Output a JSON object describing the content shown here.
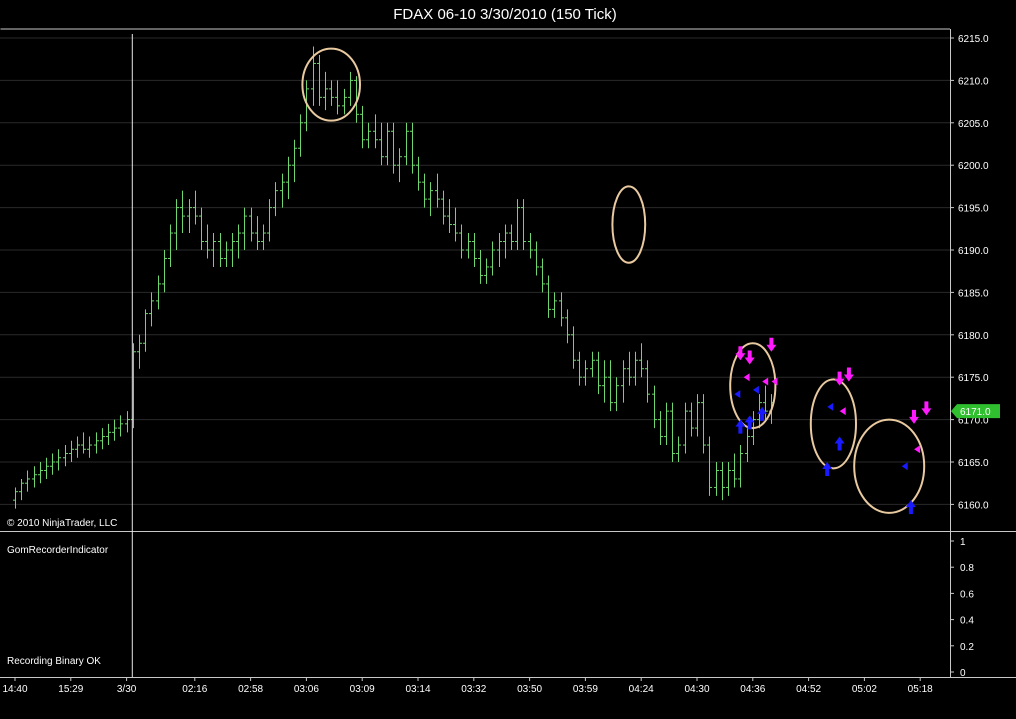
{
  "window": {
    "title": "FDAX 06-10  3/30/2010 (150 Tick)"
  },
  "copyright": "© 2010 NinjaTrader, LLC",
  "indicator_panel": {
    "name": "GomRecorderIndicator",
    "status": "Recording Binary OK",
    "ticks": [
      "1",
      "0.8",
      "0.6",
      "0.4",
      "0.2",
      "0"
    ]
  },
  "colors": {
    "background": "#000000",
    "bar": "#6fd66f",
    "frame": "#c8c8c8",
    "grid": "#2a2a2a",
    "ellipse": "#e8c9a0",
    "sell_marker": "#ff1aff",
    "buy_marker": "#1a1aff",
    "price_tag": "#2fbf2f"
  },
  "chart_data": {
    "type": "ohlc",
    "instrument": "FDAX 06-10",
    "date": "3/30/2010",
    "interval": "150 Tick",
    "y_ticks": [
      "6215.0",
      "6210.0",
      "6205.0",
      "6200.0",
      "6195.0",
      "6190.0",
      "6185.0",
      "6180.0",
      "6175.0",
      "6170.0",
      "6165.0",
      "6160.0"
    ],
    "ylim": [
      6158.5,
      6215.5
    ],
    "x_ticks": [
      {
        "label": "14:40",
        "bar": 0
      },
      {
        "label": "15:29",
        "bar": 9
      },
      {
        "label": "3/30",
        "bar": 18
      },
      {
        "label": "02:16",
        "bar": 29
      },
      {
        "label": "02:58",
        "bar": 38
      },
      {
        "label": "03:06",
        "bar": 47
      },
      {
        "label": "03:09",
        "bar": 56
      },
      {
        "label": "03:14",
        "bar": 65
      },
      {
        "label": "03:32",
        "bar": 74
      },
      {
        "label": "03:50",
        "bar": 83
      },
      {
        "label": "03:59",
        "bar": 92
      },
      {
        "label": "04:24",
        "bar": 101
      },
      {
        "label": "04:30",
        "bar": 110
      },
      {
        "label": "04:36",
        "bar": 119
      },
      {
        "label": "04:52",
        "bar": 128
      },
      {
        "label": "05:02",
        "bar": 137
      },
      {
        "label": "05:18",
        "bar": 146
      }
    ],
    "session_break_bar": 19,
    "last_price": "6171.0",
    "bars": [
      [
        6160.5,
        6162.0,
        6159.5,
        6161.5
      ],
      [
        6161.5,
        6163.0,
        6160.5,
        6162.5
      ],
      [
        6162.5,
        6164.0,
        6161.5,
        6163.0
      ],
      [
        6163.0,
        6164.5,
        6162.0,
        6163.5
      ],
      [
        6163.5,
        6165.0,
        6162.5,
        6164.0
      ],
      [
        6164.0,
        6165.5,
        6163.0,
        6164.5
      ],
      [
        6164.5,
        6166.0,
        6163.5,
        6165.0
      ],
      [
        6165.0,
        6166.5,
        6164.0,
        6165.5
      ],
      [
        6165.5,
        6167.0,
        6164.5,
        6166.0
      ],
      [
        6166.0,
        6167.5,
        6165.0,
        6166.5
      ],
      [
        6166.5,
        6168.0,
        6165.5,
        6167.0
      ],
      [
        6167.0,
        6168.5,
        6166.0,
        6166.5
      ],
      [
        6166.5,
        6168.0,
        6165.5,
        6167.0
      ],
      [
        6167.0,
        6168.5,
        6166.0,
        6167.5
      ],
      [
        6167.5,
        6169.0,
        6166.5,
        6168.0
      ],
      [
        6168.0,
        6169.5,
        6167.0,
        6168.5
      ],
      [
        6168.5,
        6170.0,
        6167.5,
        6169.0
      ],
      [
        6169.0,
        6170.5,
        6168.0,
        6169.5
      ],
      [
        6169.5,
        6171.0,
        6168.5,
        6170.0
      ],
      [
        6170.0,
        6179.0,
        6169.0,
        6178.0
      ],
      [
        6178.0,
        6180.0,
        6176.0,
        6179.0
      ],
      [
        6179.0,
        6183.0,
        6178.0,
        6182.5
      ],
      [
        6182.5,
        6185.0,
        6181.0,
        6184.0
      ],
      [
        6184.0,
        6187.0,
        6183.0,
        6186.0
      ],
      [
        6186.0,
        6190.0,
        6185.0,
        6189.0
      ],
      [
        6189.0,
        6193.0,
        6188.0,
        6192.0
      ],
      [
        6192.0,
        6196.0,
        6190.0,
        6195.0
      ],
      [
        6195.0,
        6197.0,
        6192.0,
        6194.0
      ],
      [
        6194.0,
        6196.0,
        6192.0,
        6195.0
      ],
      [
        6195.0,
        6197.0,
        6193.0,
        6194.0
      ],
      [
        6194.0,
        6195.0,
        6190.0,
        6191.0
      ],
      [
        6191.0,
        6193.0,
        6189.0,
        6190.0
      ],
      [
        6190.0,
        6192.0,
        6188.0,
        6191.0
      ],
      [
        6191.0,
        6192.0,
        6188.0,
        6189.0
      ],
      [
        6189.0,
        6191.0,
        6188.0,
        6190.0
      ],
      [
        6190.0,
        6192.0,
        6188.0,
        6191.0
      ],
      [
        6191.0,
        6193.0,
        6189.0,
        6192.0
      ],
      [
        6192.0,
        6195.0,
        6190.0,
        6194.0
      ],
      [
        6194.0,
        6195.0,
        6191.0,
        6192.0
      ],
      [
        6192.0,
        6194.0,
        6190.0,
        6191.0
      ],
      [
        6191.0,
        6193.0,
        6190.0,
        6192.0
      ],
      [
        6192.0,
        6196.0,
        6191.0,
        6195.0
      ],
      [
        6195.0,
        6198.0,
        6194.0,
        6197.0
      ],
      [
        6197.0,
        6199.0,
        6195.0,
        6198.0
      ],
      [
        6198.0,
        6201.0,
        6196.0,
        6200.0
      ],
      [
        6200.0,
        6203.0,
        6198.0,
        6202.0
      ],
      [
        6202.0,
        6206.0,
        6201.0,
        6205.0
      ],
      [
        6205.0,
        6210.0,
        6204.0,
        6209.0
      ],
      [
        6209.0,
        6214.0,
        6207.0,
        6212.0
      ],
      [
        6212.0,
        6213.0,
        6207.0,
        6208.0
      ],
      [
        6208.0,
        6211.0,
        6206.5,
        6209.0
      ],
      [
        6209.0,
        6210.0,
        6207.0,
        6208.0
      ],
      [
        6208.0,
        6210.0,
        6206.0,
        6207.0
      ],
      [
        6207.0,
        6209.0,
        6206.0,
        6208.0
      ],
      [
        6208.0,
        6211.0,
        6207.0,
        6210.0
      ],
      [
        6210.0,
        6210.5,
        6205.0,
        6206.0
      ],
      [
        6206.0,
        6207.0,
        6202.0,
        6203.0
      ],
      [
        6203.0,
        6205.0,
        6202.0,
        6204.0
      ],
      [
        6204.0,
        6206.0,
        6202.0,
        6203.0
      ],
      [
        6203.0,
        6205.0,
        6200.0,
        6201.0
      ],
      [
        6201.0,
        6205.0,
        6200.0,
        6204.0
      ],
      [
        6204.0,
        6205.0,
        6199.0,
        6200.0
      ],
      [
        6200.0,
        6202.0,
        6198.0,
        6201.0
      ],
      [
        6201.0,
        6205.0,
        6200.0,
        6204.0
      ],
      [
        6204.0,
        6205.0,
        6199.0,
        6200.0
      ],
      [
        6200.0,
        6201.0,
        6197.0,
        6198.0
      ],
      [
        6198.0,
        6199.0,
        6195.0,
        6196.0
      ],
      [
        6196.0,
        6198.0,
        6194.0,
        6197.0
      ],
      [
        6197.0,
        6199.0,
        6195.0,
        6196.0
      ],
      [
        6196.0,
        6197.0,
        6193.0,
        6194.0
      ],
      [
        6194.0,
        6196.0,
        6192.0,
        6193.0
      ],
      [
        6193.0,
        6195.0,
        6191.0,
        6192.0
      ],
      [
        6192.0,
        6193.0,
        6189.0,
        6190.0
      ],
      [
        6190.0,
        6192.0,
        6189.0,
        6191.0
      ],
      [
        6191.0,
        6192.0,
        6188.0,
        6189.0
      ],
      [
        6189.0,
        6190.0,
        6186.0,
        6187.0
      ],
      [
        6187.0,
        6189.0,
        6186.0,
        6188.0
      ],
      [
        6188.0,
        6191.0,
        6187.0,
        6190.0
      ],
      [
        6190.0,
        6192.0,
        6188.0,
        6191.0
      ],
      [
        6191.0,
        6193.0,
        6189.0,
        6192.0
      ],
      [
        6192.0,
        6193.0,
        6190.0,
        6191.0
      ],
      [
        6191.0,
        6196.0,
        6190.0,
        6195.0
      ],
      [
        6195.0,
        6196.0,
        6190.0,
        6191.0
      ],
      [
        6191.0,
        6192.0,
        6189.0,
        6190.0
      ],
      [
        6190.0,
        6191.0,
        6187.0,
        6188.0
      ],
      [
        6188.0,
        6189.0,
        6185.0,
        6186.0
      ],
      [
        6186.0,
        6187.0,
        6182.0,
        6183.0
      ],
      [
        6183.0,
        6185.0,
        6182.0,
        6184.0
      ],
      [
        6184.0,
        6185.0,
        6181.0,
        6182.0
      ],
      [
        6182.0,
        6183.0,
        6179.0,
        6180.0
      ],
      [
        6180.0,
        6181.0,
        6176.0,
        6177.0
      ],
      [
        6177.0,
        6178.0,
        6174.0,
        6175.0
      ],
      [
        6175.0,
        6177.0,
        6174.0,
        6176.0
      ],
      [
        6176.0,
        6178.0,
        6175.0,
        6177.0
      ],
      [
        6177.0,
        6178.0,
        6173.0,
        6174.0
      ],
      [
        6174.0,
        6177.0,
        6172.0,
        6175.0
      ],
      [
        6175.0,
        6177.0,
        6171.0,
        6172.0
      ],
      [
        6172.0,
        6175.0,
        6171.0,
        6174.0
      ],
      [
        6174.0,
        6177.0,
        6172.0,
        6176.0
      ],
      [
        6176.0,
        6178.0,
        6174.0,
        6175.0
      ],
      [
        6175.0,
        6178.0,
        6174.0,
        6177.0
      ],
      [
        6177.0,
        6179.0,
        6175.0,
        6176.0
      ],
      [
        6176.0,
        6177.0,
        6172.0,
        6173.0
      ],
      [
        6173.0,
        6174.0,
        6169.0,
        6170.0
      ],
      [
        6170.0,
        6171.0,
        6167.0,
        6168.0
      ],
      [
        6168.0,
        6172.0,
        6167.0,
        6171.0
      ],
      [
        6171.0,
        6172.0,
        6165.0,
        6166.0
      ],
      [
        6166.0,
        6168.0,
        6165.0,
        6167.0
      ],
      [
        6167.0,
        6172.0,
        6166.0,
        6171.0
      ],
      [
        6171.0,
        6172.0,
        6168.0,
        6169.0
      ],
      [
        6169.0,
        6173.0,
        6168.0,
        6172.0
      ],
      [
        6172.0,
        6173.0,
        6166.0,
        6167.0
      ],
      [
        6167.0,
        6168.0,
        6161.0,
        6162.0
      ],
      [
        6162.0,
        6165.0,
        6161.0,
        6164.0
      ],
      [
        6164.0,
        6165.0,
        6160.5,
        6162.0
      ],
      [
        6162.0,
        6165.0,
        6161.0,
        6164.0
      ],
      [
        6164.0,
        6166.0,
        6162.0,
        6163.0
      ],
      [
        6163.0,
        6167.0,
        6162.0,
        6166.0
      ],
      [
        6166.0,
        6169.0,
        6165.0,
        6168.0
      ],
      [
        6168.0,
        6171.0,
        6167.0,
        6170.0
      ],
      [
        6170.0,
        6173.0,
        6169.0,
        6172.0
      ],
      [
        6172.0,
        6174.0,
        6170.0,
        6171.0
      ],
      [
        6171.0,
        6173.0,
        6169.5,
        6172.0
      ]
    ],
    "annotations": {
      "ellipses": [
        {
          "bar": 51,
          "price": 6209.5,
          "bar_span": 8,
          "price_span": 8.5
        },
        {
          "bar": 99,
          "price": 6193.0,
          "bar_span": 4,
          "price_span": 9.0
        },
        {
          "bar": 119,
          "price": 6174.0,
          "bar_span": 6,
          "price_span": 10.0
        },
        {
          "bar": 132,
          "price": 6169.5,
          "bar_span": 6,
          "price_span": 10.5
        },
        {
          "bar": 141,
          "price": 6164.5,
          "bar_span": 10,
          "price_span": 11.0
        }
      ],
      "down_arrows": [
        {
          "bar": 117,
          "price": 6177.0
        },
        {
          "bar": 118.5,
          "price": 6176.5
        },
        {
          "bar": 122,
          "price": 6178.0
        },
        {
          "bar": 133,
          "price": 6174.0
        },
        {
          "bar": 134.5,
          "price": 6174.5
        },
        {
          "bar": 145,
          "price": 6169.5
        },
        {
          "bar": 147,
          "price": 6170.5
        }
      ],
      "up_arrows": [
        {
          "bar": 117,
          "price": 6170.0
        },
        {
          "bar": 118.5,
          "price": 6170.5
        },
        {
          "bar": 120.5,
          "price": 6171.5
        },
        {
          "bar": 131,
          "price": 6165.0
        },
        {
          "bar": 133,
          "price": 6168.0
        },
        {
          "bar": 144.5,
          "price": 6160.5
        }
      ],
      "sell_triangles": [
        {
          "bar": 118,
          "price": 6175.0
        },
        {
          "bar": 121,
          "price": 6174.5
        },
        {
          "bar": 122.5,
          "price": 6174.5
        },
        {
          "bar": 133.5,
          "price": 6171.0
        },
        {
          "bar": 145.5,
          "price": 6166.5
        }
      ],
      "buy_triangles": [
        {
          "bar": 116.5,
          "price": 6173.0
        },
        {
          "bar": 119.5,
          "price": 6173.5
        },
        {
          "bar": 131.5,
          "price": 6171.5
        },
        {
          "bar": 143.5,
          "price": 6164.5
        }
      ]
    }
  }
}
